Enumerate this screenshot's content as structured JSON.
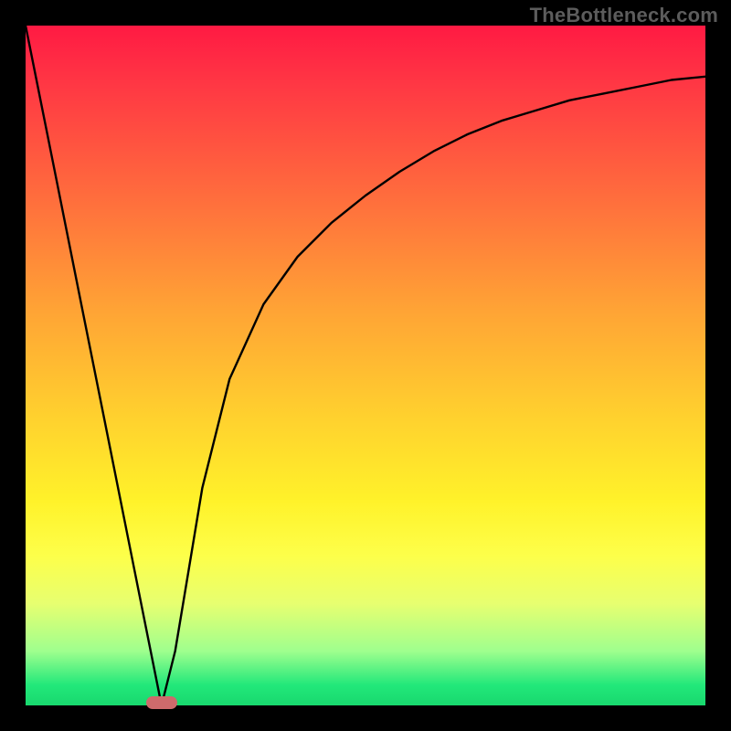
{
  "watermark": "TheBottleneck.com",
  "colors": {
    "gradient_top": "#ff1a43",
    "gradient_bottom": "#18d86e",
    "curve": "#000000",
    "marker": "#ce6a6c",
    "frame": "#000000"
  },
  "chart_data": {
    "type": "line",
    "title": "",
    "xlabel": "",
    "ylabel": "",
    "xlim": [
      0,
      100
    ],
    "ylim": [
      0,
      100
    ],
    "x": [
      0,
      4,
      8,
      12,
      16,
      18,
      20,
      22,
      24,
      26,
      30,
      35,
      40,
      45,
      50,
      55,
      60,
      65,
      70,
      75,
      80,
      85,
      90,
      95,
      100
    ],
    "values": [
      100,
      80,
      60,
      40,
      20,
      10,
      0,
      8,
      20,
      32,
      48,
      59,
      66,
      71,
      75,
      78.5,
      81.5,
      84,
      86,
      87.5,
      89,
      90,
      91,
      92,
      92.5
    ],
    "marker": {
      "x": 20,
      "y": 0
    },
    "grid": false,
    "legend": false,
    "annotations": []
  }
}
